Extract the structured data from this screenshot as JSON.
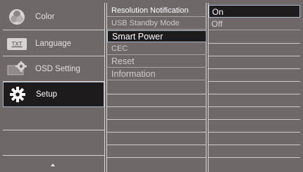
{
  "main_menu": [
    {
      "label": "Color",
      "icon": "color-wheel-icon",
      "selected": false
    },
    {
      "label": "Language",
      "icon": "txt-icon",
      "icon_text": "TXT",
      "selected": false
    },
    {
      "label": "OSD Setting",
      "icon": "monitor-gear-icon",
      "selected": false
    },
    {
      "label": "Setup",
      "icon": "gear-icon",
      "selected": true
    }
  ],
  "sub_menu": [
    {
      "label": "Resolution Notification",
      "state": "enabled"
    },
    {
      "label": "USB Standby Mode",
      "state": "disabled"
    },
    {
      "label": "Smart Power",
      "state": "selected"
    },
    {
      "label": "CEC",
      "state": "disabled"
    },
    {
      "label": "Reset",
      "state": "disabled"
    },
    {
      "label": "Information",
      "state": "disabled"
    }
  ],
  "options": [
    {
      "label": "On",
      "selected": true
    },
    {
      "label": "Off",
      "selected": false
    }
  ],
  "colors": {
    "background": "#6e6869",
    "selected_bg": "#1e1b1c",
    "selected_border": "#a7b9c8"
  }
}
